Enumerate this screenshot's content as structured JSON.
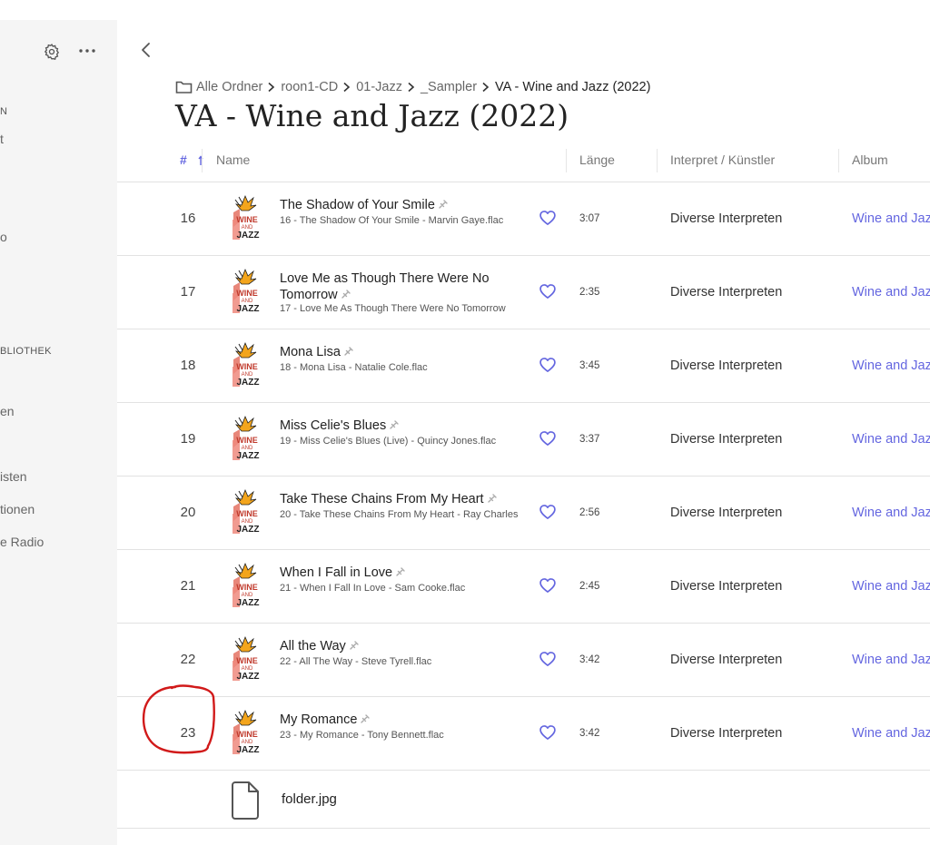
{
  "sidebar": {
    "items": [
      {
        "label": "N",
        "kind": "head"
      },
      {
        "label": "t",
        "kind": "item"
      },
      {
        "label": "o",
        "kind": "item"
      },
      {
        "label": "BLIOTHEK",
        "kind": "head"
      },
      {
        "label": "en",
        "kind": "item"
      },
      {
        "label": "isten",
        "kind": "item"
      },
      {
        "label": "tionen",
        "kind": "item"
      },
      {
        "label": "e Radio",
        "kind": "item"
      }
    ]
  },
  "breadcrumb": [
    "Alle Ordner",
    "roon1-CD",
    "01-Jazz",
    "_Sampler",
    "VA - Wine and Jazz (2022)"
  ],
  "page_title": "VA - Wine and Jazz (2022)",
  "columns": {
    "num": "#",
    "name": "Name",
    "length": "Länge",
    "artist": "Interpret / Künstler",
    "album": "Album"
  },
  "tracks": [
    {
      "num": "16",
      "title": "The Shadow of Your Smile",
      "file": "16 - The Shadow Of Your Smile - Marvin Gaye.flac",
      "length": "3:07",
      "artist": "Diverse Interpreten",
      "album": "Wine and Jazz"
    },
    {
      "num": "17",
      "title": "Love Me as Though There Were No Tomorrow",
      "file": "17 - Love Me As Though There Were No Tomorrow",
      "length": "2:35",
      "artist": "Diverse Interpreten",
      "album": "Wine and Jazz"
    },
    {
      "num": "18",
      "title": "Mona Lisa",
      "file": "18 - Mona Lisa - Natalie Cole.flac",
      "length": "3:45",
      "artist": "Diverse Interpreten",
      "album": "Wine and Jazz"
    },
    {
      "num": "19",
      "title": "Miss Celie's Blues",
      "file": "19 - Miss Celie's Blues (Live) - Quincy Jones.flac",
      "length": "3:37",
      "artist": "Diverse Interpreten",
      "album": "Wine and Jazz"
    },
    {
      "num": "20",
      "title": "Take These Chains From My Heart",
      "file": "20 - Take These Chains From My Heart - Ray Charles",
      "length": "2:56",
      "artist": "Diverse Interpreten",
      "album": "Wine and Jazz"
    },
    {
      "num": "21",
      "title": "When I Fall in Love",
      "file": "21 - When I Fall In Love - Sam Cooke.flac",
      "length": "2:45",
      "artist": "Diverse Interpreten",
      "album": "Wine and Jazz"
    },
    {
      "num": "22",
      "title": "All the Way",
      "file": "22 - All The Way - Steve Tyrell.flac",
      "length": "3:42",
      "artist": "Diverse Interpreten",
      "album": "Wine and Jazz"
    },
    {
      "num": "23",
      "title": "My Romance",
      "file": "23 - My Romance - Tony Bennett.flac",
      "length": "3:42",
      "artist": "Diverse Interpreten",
      "album": "Wine and Jazz"
    }
  ],
  "extra_file": {
    "name": "folder.jpg",
    "icon": "file-icon"
  },
  "colors": {
    "accent": "#6466e0",
    "annotation": "#d11a1a",
    "sidebar_bg": "#f5f5f5"
  }
}
